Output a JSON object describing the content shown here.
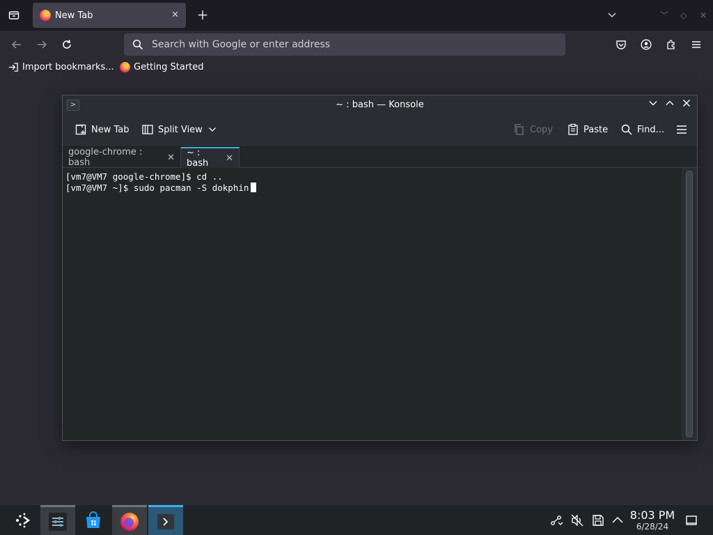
{
  "browser": {
    "tabs": [
      {
        "label": "New Tab"
      }
    ],
    "url_placeholder": "Search with Google or enter address",
    "bookmarks": [
      {
        "label": "Import bookmarks..."
      },
      {
        "label": "Getting Started"
      }
    ]
  },
  "konsole": {
    "window_title": "~ : bash — Konsole",
    "toolbar": {
      "new_tab": "New Tab",
      "split_view": "Split View",
      "copy": "Copy",
      "paste": "Paste",
      "find": "Find..."
    },
    "tabs": [
      {
        "label": "google-chrome : bash",
        "active": false
      },
      {
        "label": "~ : bash",
        "active": true
      }
    ],
    "terminal_lines": [
      "[vm7@VM7 google-chrome]$ cd ..",
      "[vm7@VM7 ~]$ sudo pacman -S dokphin"
    ]
  },
  "taskbar": {
    "time": "8:03 PM",
    "date": "6/28/24"
  },
  "colors": {
    "accent": "#3daee9",
    "terminal_bg": "#232627",
    "firefox_bg": "#2b2a33"
  }
}
